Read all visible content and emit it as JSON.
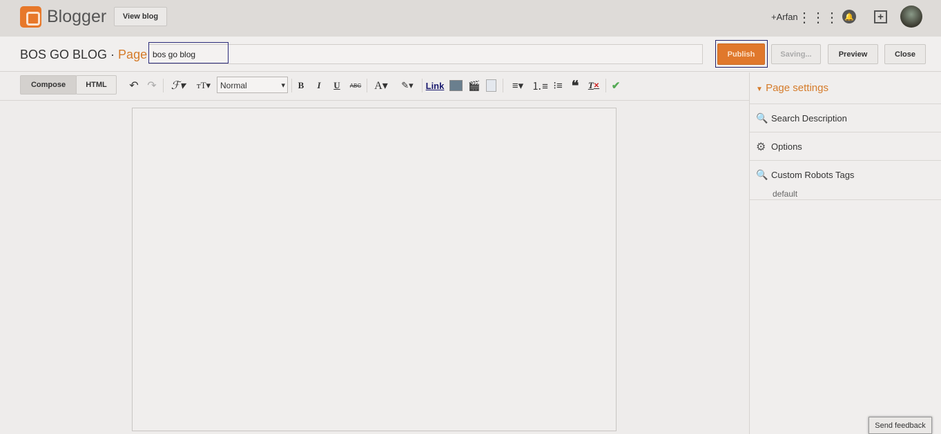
{
  "header": {
    "brand": "Blogger",
    "view_blog": "View blog",
    "user": "+Arfan"
  },
  "title_row": {
    "blog_name": "BOS GO BLOG",
    "separator": " · ",
    "type": "Page",
    "title_value": "bos go blog"
  },
  "actions": {
    "publish": "Publish",
    "saving": "Saving...",
    "preview": "Preview",
    "close": "Close"
  },
  "toolbar": {
    "compose": "Compose",
    "html": "HTML",
    "format_select": "Normal",
    "bold": "B",
    "italic": "I",
    "underline": "U",
    "strike": "ABC",
    "link": "Link"
  },
  "sidebar": {
    "heading": "Page settings",
    "items": [
      {
        "label": "Search Description",
        "icon": "search-icon"
      },
      {
        "label": "Options",
        "icon": "gear-icon"
      },
      {
        "label": "Custom Robots Tags",
        "icon": "search-icon",
        "value": "default"
      }
    ]
  },
  "feedback": "Send feedback",
  "colors": {
    "accent": "#e0782c",
    "topbar": "#dedbd8"
  }
}
